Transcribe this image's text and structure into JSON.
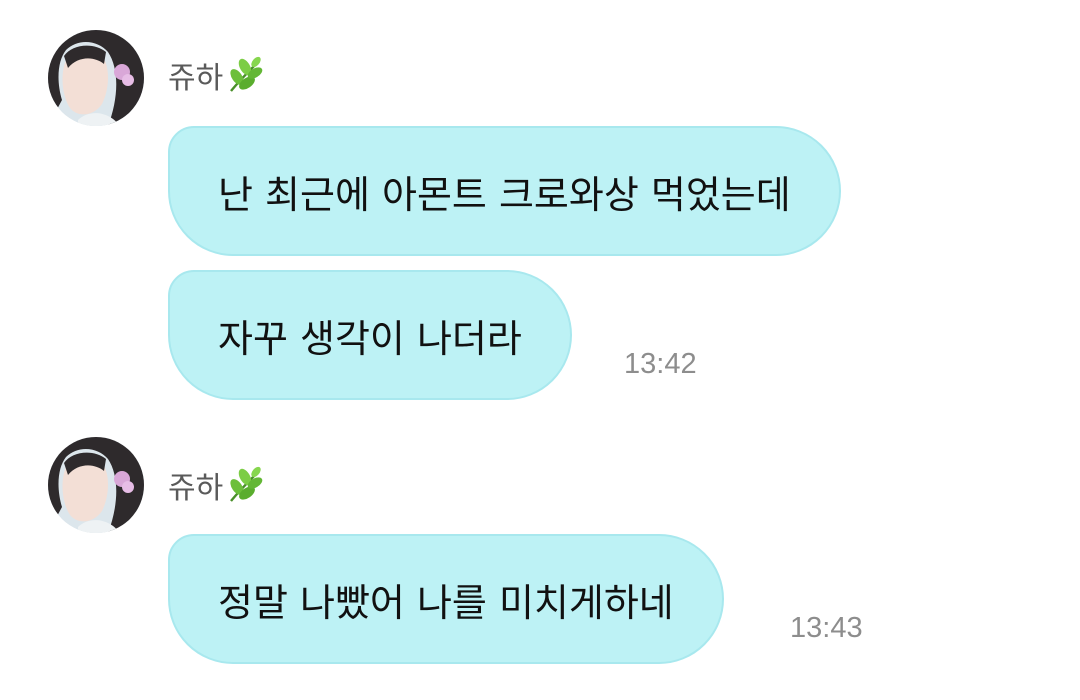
{
  "groups": [
    {
      "sender": {
        "name": "쥬하",
        "avatar_icon": "profile-photo-icon",
        "badge_icon": "herb-leaf-icon"
      },
      "messages": [
        {
          "text": "난 최근에 아몬트 크로와상 먹었는데"
        },
        {
          "text": "자꾸 생각이 나더라",
          "time": "13:42"
        }
      ]
    },
    {
      "sender": {
        "name": "쥬하",
        "avatar_icon": "profile-photo-icon",
        "badge_icon": "herb-leaf-icon"
      },
      "messages": [
        {
          "text": "정말 나빴어 나를 미치게하네",
          "time": "13:43"
        }
      ]
    }
  ],
  "colors": {
    "bubble": "#bdf2f5",
    "bubble_border": "#a8e8ee",
    "timestamp": "#8d8d8d",
    "sender_name": "#5a5a5a"
  }
}
